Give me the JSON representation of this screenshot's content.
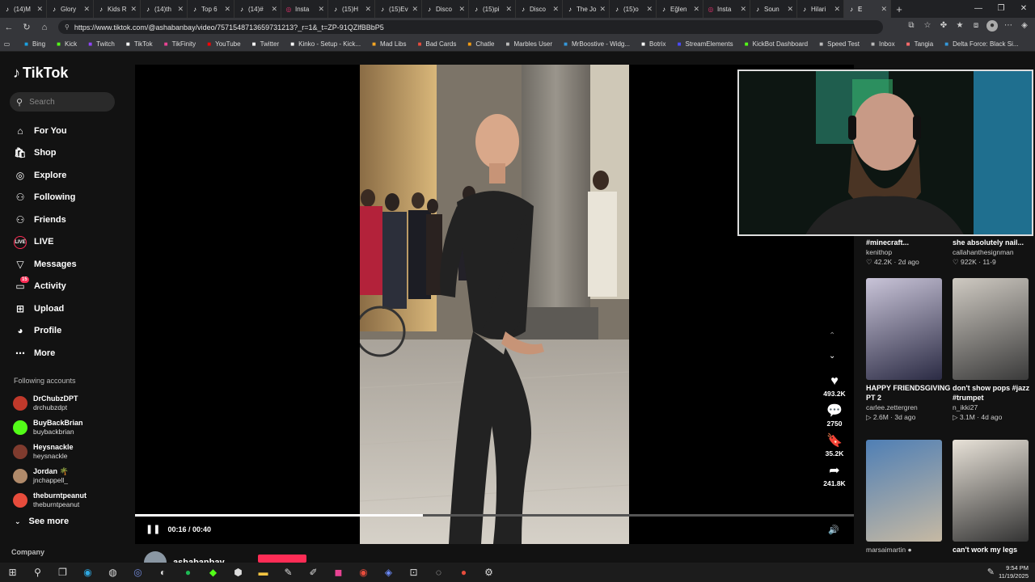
{
  "browser": {
    "tabs": [
      {
        "label": "(14)M",
        "icon": "tiktok-icon"
      },
      {
        "label": "Glory",
        "icon": "tiktok-icon"
      },
      {
        "label": "Kids R",
        "icon": "tiktok-icon"
      },
      {
        "label": "(14)th",
        "icon": "tiktok-icon"
      },
      {
        "label": "Top 6",
        "icon": "tiktok-icon"
      },
      {
        "label": "(14)#",
        "icon": "tiktok-icon"
      },
      {
        "label": "Insta",
        "icon": "instagram-icon"
      },
      {
        "label": "(15)H",
        "icon": "tiktok-icon"
      },
      {
        "label": "(15)Ev",
        "icon": "tiktok-icon"
      },
      {
        "label": "Disco",
        "icon": "tiktok-icon"
      },
      {
        "label": "(15)pi",
        "icon": "tiktok-icon"
      },
      {
        "label": "Disco",
        "icon": "tiktok-icon"
      },
      {
        "label": "The Jo",
        "icon": "tiktok-icon"
      },
      {
        "label": "(15)o",
        "icon": "tiktok-icon"
      },
      {
        "label": "Eğlen",
        "icon": "tiktok-icon"
      },
      {
        "label": "Insta",
        "icon": "instagram-icon"
      },
      {
        "label": "Soun",
        "icon": "tiktok-icon"
      },
      {
        "label": "Hilari",
        "icon": "tiktok-icon"
      },
      {
        "label": "E",
        "icon": "tiktok-icon",
        "active": true
      }
    ],
    "url": "https://www.tiktok.com/@ashabanbay/video/7571548713659731213?_r=1&_t=ZP-91QZlfBBbP5",
    "bookmarks": [
      {
        "label": "Bing",
        "color": "#1ba1e2"
      },
      {
        "label": "Kick",
        "color": "#53fc18"
      },
      {
        "label": "Twitch",
        "color": "#9146ff"
      },
      {
        "label": "TikTok",
        "color": "#ffffff"
      },
      {
        "label": "TikFinity",
        "color": "#e84393"
      },
      {
        "label": "YouTube",
        "color": "#ff0000"
      },
      {
        "label": "Twitter",
        "color": "#ffffff"
      },
      {
        "label": "Kinko - Setup - Kick...",
        "color": "#ffffff"
      },
      {
        "label": "Mad Libs",
        "color": "#f5a623"
      },
      {
        "label": "Bad Cards",
        "color": "#e74c3c"
      },
      {
        "label": "Chatle",
        "color": "#f39c12"
      },
      {
        "label": "Marbles User",
        "color": "#bbbbbb"
      },
      {
        "label": "MrBoostive - Widg...",
        "color": "#3498db"
      },
      {
        "label": "Botrix",
        "color": "#ffffff"
      },
      {
        "label": "StreamElements",
        "color": "#4b4bff"
      },
      {
        "label": "KickBot Dashboard",
        "color": "#53fc18"
      },
      {
        "label": "Speed Test",
        "color": "#bbbbbb"
      },
      {
        "label": "Inbox",
        "color": "#bbbbbb"
      },
      {
        "label": "Tangia",
        "color": "#ff6b6b"
      },
      {
        "label": "Delta Force: Black Si...",
        "color": "#3498db"
      }
    ]
  },
  "tiktok": {
    "logo_text": "TikTok",
    "search_placeholder": "Search",
    "nav": [
      {
        "label": "For You",
        "icon": "home-icon"
      },
      {
        "label": "Shop",
        "icon": "shop-icon"
      },
      {
        "label": "Explore",
        "icon": "compass-icon"
      },
      {
        "label": "Following",
        "icon": "following-icon"
      },
      {
        "label": "Friends",
        "icon": "friends-icon"
      },
      {
        "label": "LIVE",
        "icon": "live-icon"
      },
      {
        "label": "Messages",
        "icon": "messages-icon"
      },
      {
        "label": "Activity",
        "icon": "activity-icon",
        "badge": "15"
      },
      {
        "label": "Upload",
        "icon": "upload-icon"
      },
      {
        "label": "Profile",
        "icon": "profile-icon"
      },
      {
        "label": "More",
        "icon": "more-icon"
      }
    ],
    "following_title": "Following accounts",
    "following": [
      {
        "name": "DrChubzDPT",
        "handle": "drchubzdpt",
        "color": "#c0392b"
      },
      {
        "name": "BuyBackBrian",
        "handle": "buybackbrian",
        "color": "#53fc18"
      },
      {
        "name": "Heysnackle",
        "handle": "heysnackle",
        "color": "#7f3b2e"
      },
      {
        "name": "Jordan 🌴",
        "handle": "jnchappell_",
        "color": "#b08a6a"
      },
      {
        "name": "theburntpeanut",
        "handle": "theburntpeanut",
        "color": "#e74c3c"
      }
    ],
    "see_more": "See more",
    "company": "Company",
    "player": {
      "time": "00:16 / 00:40",
      "progress": 0.4,
      "author": "ashabanbay"
    },
    "actions": [
      {
        "icon": "heart-icon",
        "count": "493.2K"
      },
      {
        "icon": "comment-icon",
        "count": "2750"
      },
      {
        "icon": "bookmark-icon",
        "count": "35.2K"
      },
      {
        "icon": "share-icon",
        "count": "241.8K"
      }
    ],
    "related": [
      {
        "title": "#minecraft...",
        "user": "kenithop",
        "stats": "♡ 42.2K · 2d ago",
        "top": true
      },
      {
        "title": "she absolutely nail...",
        "user": "callahanthesignman",
        "stats": "♡ 922K · 11-9",
        "top": true
      },
      {
        "title": "HAPPY FRIENDSGIVING PT 2",
        "user": "carlee.zettergren",
        "stats": "▷ 2.6M · 3d ago"
      },
      {
        "title": "don't show pops #jazz #trumpet",
        "user": "n_ikki27",
        "stats": "▷ 3.1M · 4d ago"
      },
      {
        "title": "",
        "user": "marsaimartin ●",
        "stats": ""
      },
      {
        "title": "can't work my legs",
        "user": "",
        "stats": ""
      }
    ]
  },
  "taskbar": {
    "time": "9:54 PM",
    "date": "11/19/2025"
  }
}
